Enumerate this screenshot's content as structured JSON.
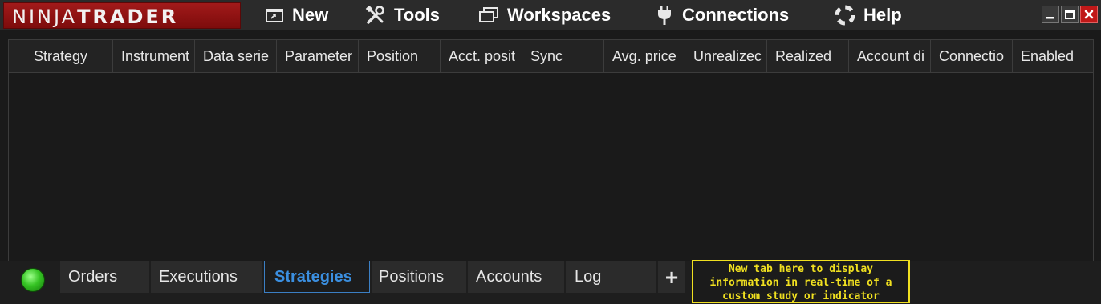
{
  "app": {
    "logo_light": "NINJA",
    "logo_bold": "TRADER"
  },
  "menu": [
    {
      "label": "New",
      "icon": "new-window-icon"
    },
    {
      "label": "Tools",
      "icon": "tools-icon"
    },
    {
      "label": "Workspaces",
      "icon": "workspaces-icon"
    },
    {
      "label": "Connections",
      "icon": "plug-icon"
    },
    {
      "label": "Help",
      "icon": "help-lifebuoy-icon"
    }
  ],
  "window_controls": [
    "minimize",
    "maximize",
    "close"
  ],
  "grid": {
    "columns": [
      "Strategy",
      "Instrument",
      "Data serie",
      "Parameter",
      "Position",
      "Acct. posit",
      "Sync",
      "Avg. price",
      "Unrealizec",
      "Realized",
      "Account di",
      "Connectio",
      "Enabled"
    ],
    "rows": []
  },
  "tabs": [
    {
      "label": "Orders",
      "active": false
    },
    {
      "label": "Executions",
      "active": false
    },
    {
      "label": "Strategies",
      "active": true
    },
    {
      "label": "Positions",
      "active": false
    },
    {
      "label": "Accounts",
      "active": false
    },
    {
      "label": "Log",
      "active": false
    }
  ],
  "add_tab_label": "+",
  "annotation": {
    "lines": [
      "New tab here to display",
      "information in real-time of a",
      "custom study or indicator"
    ]
  },
  "colors": {
    "brand_red": "#a21a1a",
    "active_tab_blue": "#3b8fe0",
    "annotation_yellow": "#f0e020",
    "status_green": "#36c424"
  }
}
